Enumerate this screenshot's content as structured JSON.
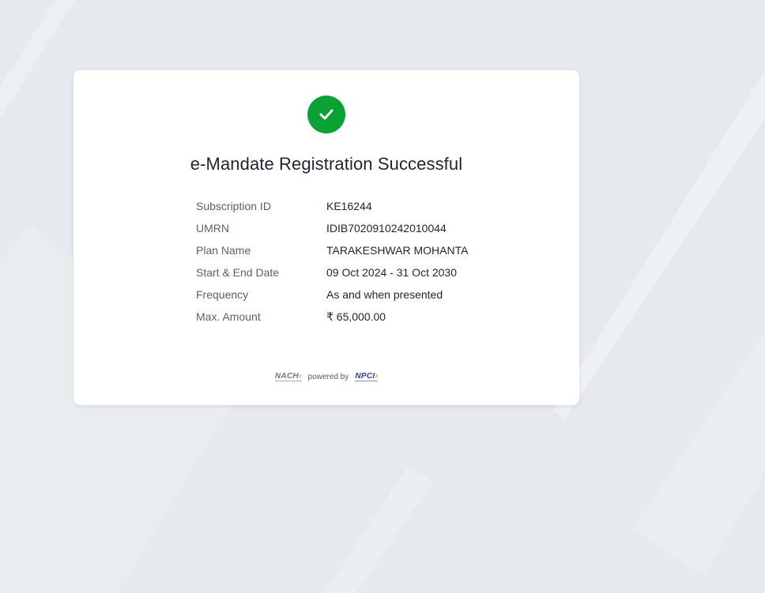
{
  "title": "e-Mandate Registration Successful",
  "details": [
    {
      "label": "Subscription ID",
      "value": "KE16244"
    },
    {
      "label": "UMRN",
      "value": "IDIB7020910242010044"
    },
    {
      "label": "Plan Name",
      "value": "TARAKESHWAR MOHANTA"
    },
    {
      "label": "Start & End Date",
      "value": "09 Oct 2024 - 31 Oct 2030"
    },
    {
      "label": "Frequency",
      "value": "As and when presented"
    },
    {
      "label": "Max. Amount",
      "value": "₹ 65,000.00"
    }
  ],
  "footer": {
    "nach_logo": "NACH",
    "powered_by": "powered by",
    "npci_logo": "NPCI"
  },
  "colors": {
    "success": "#0aa235",
    "background": "#e6e9ed",
    "card": "#ffffff"
  },
  "icons": {
    "status": "check-icon"
  }
}
